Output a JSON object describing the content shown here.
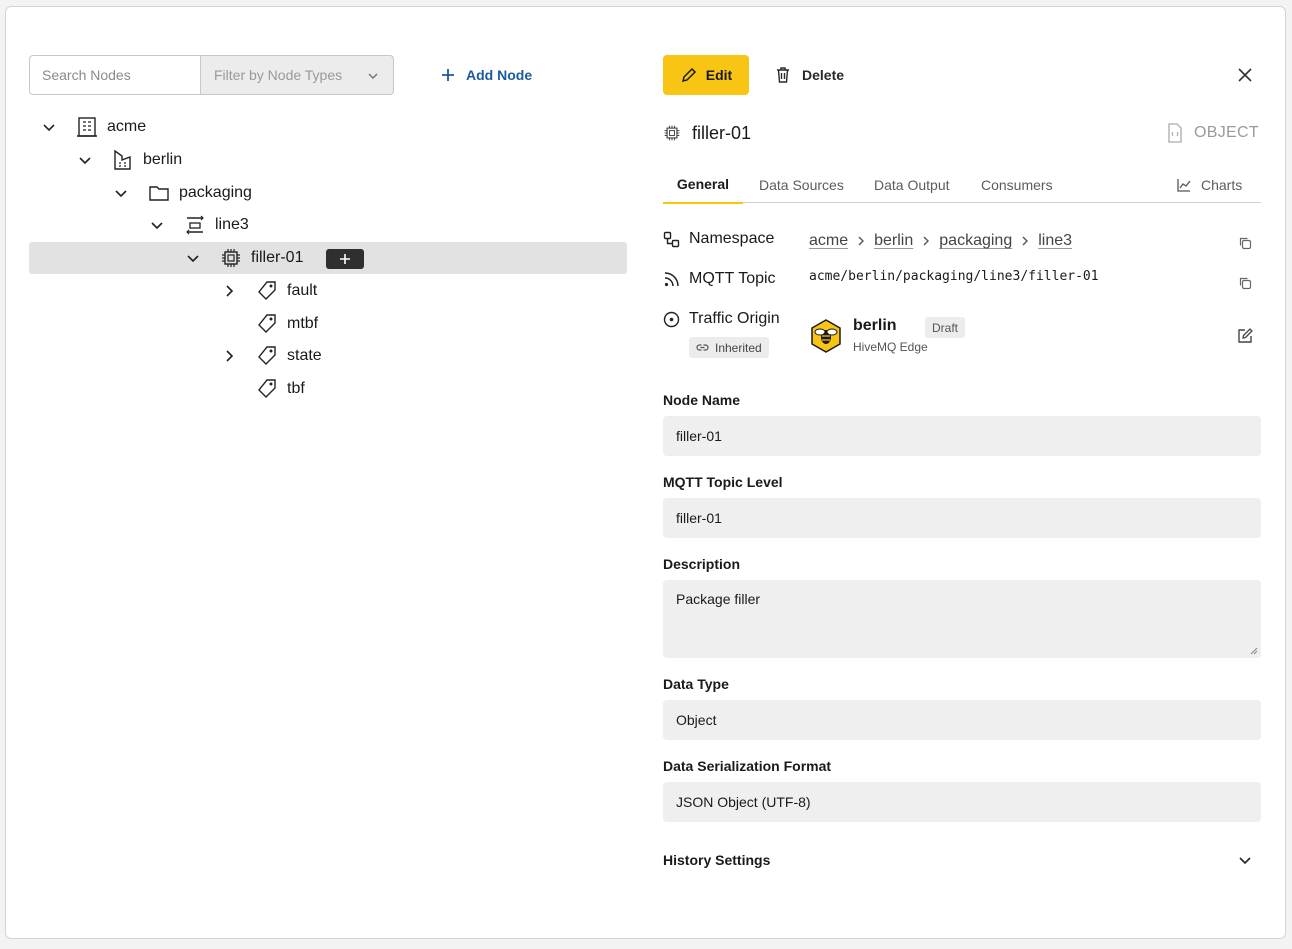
{
  "tree_panel": {
    "search": {
      "placeholder": "Search Nodes"
    },
    "filter": {
      "placeholder": "Filter by Node Types"
    },
    "add_node_label": "Add Node",
    "nodes": [
      {
        "label": "acme",
        "icon": "enterprise-icon",
        "expanded": true
      },
      {
        "label": "berlin",
        "icon": "site-icon",
        "expanded": true
      },
      {
        "label": "packaging",
        "icon": "folder-icon",
        "expanded": true
      },
      {
        "label": "line3",
        "icon": "line-icon",
        "expanded": true
      },
      {
        "label": "filler-01",
        "icon": "chip-icon",
        "expanded": true,
        "selected": true
      },
      {
        "label": "fault",
        "icon": "tag-icon",
        "expanded": false
      },
      {
        "label": "mtbf",
        "icon": "tag-icon"
      },
      {
        "label": "state",
        "icon": "tag-icon",
        "expanded": false
      },
      {
        "label": "tbf",
        "icon": "tag-icon"
      }
    ]
  },
  "toolbar": {
    "edit_label": "Edit",
    "delete_label": "Delete"
  },
  "detail": {
    "title": "filler-01",
    "type_label": "OBJECT",
    "tabs": [
      "General",
      "Data Sources",
      "Data Output",
      "Consumers",
      "Charts"
    ],
    "active_tab": "General",
    "namespace": {
      "label": "Namespace",
      "crumbs": [
        "acme",
        "berlin",
        "packaging",
        "line3"
      ]
    },
    "mqtt_topic": {
      "label": "MQTT Topic",
      "value": "acme/berlin/packaging/line3/filler-01"
    },
    "traffic_origin": {
      "label": "Traffic Origin",
      "inherited_label": "Inherited",
      "name": "berlin",
      "subtitle": "HiveMQ Edge",
      "badge": "Draft"
    },
    "fields": {
      "node_name": {
        "label": "Node Name",
        "value": "filler-01"
      },
      "mqtt_topic_level": {
        "label": "MQTT Topic Level",
        "value": "filler-01"
      },
      "description": {
        "label": "Description",
        "value": "Package filler"
      },
      "data_type": {
        "label": "Data Type",
        "value": "Object"
      },
      "serialization": {
        "label": "Data Serialization Format",
        "value": "JSON Object (UTF-8)"
      }
    },
    "history_label": "History Settings"
  },
  "colors": {
    "accent": "#f9c515",
    "link": "#1c5a9c",
    "field_bg": "#efefef",
    "selected_row": "#e2e2e2"
  }
}
